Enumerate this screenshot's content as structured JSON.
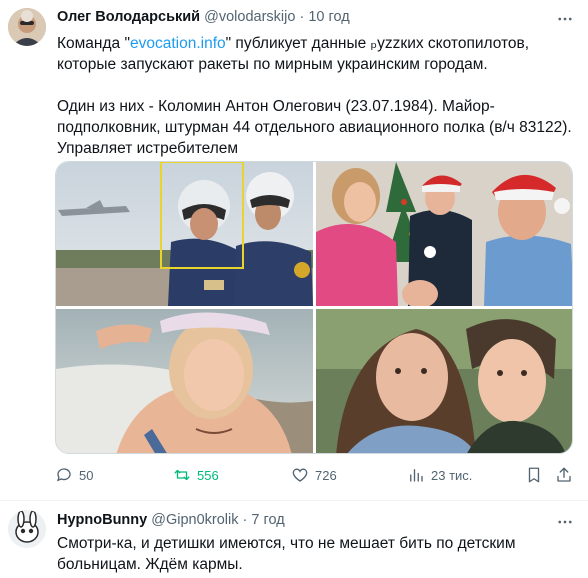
{
  "tweet": {
    "author_name": "Олег Володарський",
    "author_handle": "@volodarskijo",
    "separator": "·",
    "time": "10 год",
    "text_before_link": "Команда \"",
    "link_text": "evocation.info",
    "text_after_link": "\" публикует данные ₚyzzких скотопилотов, которые запускают ракеты по мирным украинским городам.",
    "paragraph2": "Один из них - Коломин Антон Олегович (23.07.1984). Майор-подполковник,  штурман 44 отдельного авиационного полка (в/ч 83122). Управляет истребителем",
    "stats": {
      "replies": "50",
      "retweets": "556",
      "likes": "726",
      "views": "23 тис."
    }
  },
  "reply": {
    "author_name": "HypnoBunny",
    "author_handle": "@Gipn0krolik",
    "separator": "·",
    "time": "7 год",
    "text": "Смотри-ка, и детишки имеются, что не мешает бить по детским больницам. Ждём кармы."
  },
  "colors": {
    "link": "#1d9bf0",
    "secondary": "#536471",
    "retweet_active": "#00ba7c",
    "text": "#0f1419"
  },
  "icons": [
    "more-icon",
    "reply-icon",
    "retweet-icon",
    "like-icon",
    "views-icon",
    "bookmark-icon",
    "share-icon"
  ]
}
